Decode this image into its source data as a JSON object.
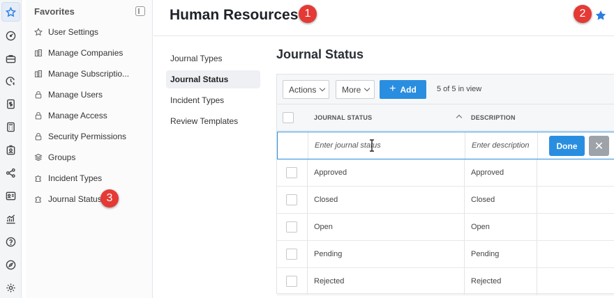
{
  "rail": {
    "icons": [
      "star-icon",
      "dashboard-icon",
      "briefcase-icon",
      "clock-money-icon",
      "dollar-document-icon",
      "calculator-icon",
      "badge-user-icon",
      "network-icon",
      "id-card-icon",
      "analytics-icon",
      "help-icon",
      "compass-icon",
      "settings-icon"
    ]
  },
  "favorites": {
    "heading": "Favorites",
    "items": [
      {
        "label": "User Settings",
        "icon": "star-outline-icon"
      },
      {
        "label": "Manage Companies",
        "icon": "buildings-icon"
      },
      {
        "label": "Manage Subscriptio...",
        "icon": "buildings-icon"
      },
      {
        "label": "Manage Users",
        "icon": "lock-icon"
      },
      {
        "label": "Manage Access",
        "icon": "lock-icon"
      },
      {
        "label": "Security Permissions",
        "icon": "lock-icon"
      },
      {
        "label": "Groups",
        "icon": "layers-icon"
      },
      {
        "label": "Incident Types",
        "icon": "puzzle-icon"
      },
      {
        "label": "Journal Status",
        "icon": "puzzle-icon"
      }
    ]
  },
  "header": {
    "title": "Human Resources"
  },
  "badges": [
    "1",
    "2",
    "3"
  ],
  "subnav": {
    "items": [
      "Journal Types",
      "Journal Status",
      "Incident Types",
      "Review Templates"
    ],
    "active": "Journal Status"
  },
  "main": {
    "title": "Journal Status",
    "toolbar": {
      "actions_label": "Actions",
      "more_label": "More",
      "add_label": "Add",
      "count_text": "5 of 5 in view"
    },
    "columns": [
      "JOURNAL STATUS",
      "DESCRIPTION"
    ],
    "edit_row": {
      "status_placeholder": "Enter journal status",
      "description_placeholder": "Enter description",
      "done_label": "Done",
      "cancel_label": "✕"
    },
    "rows": [
      {
        "status": "Approved",
        "description": "Approved"
      },
      {
        "status": "Closed",
        "description": "Closed"
      },
      {
        "status": "Open",
        "description": "Open"
      },
      {
        "status": "Pending",
        "description": "Pending"
      },
      {
        "status": "Rejected",
        "description": "Rejected"
      }
    ]
  },
  "colors": {
    "accent": "#2a8ee0",
    "badge": "#e53935"
  }
}
